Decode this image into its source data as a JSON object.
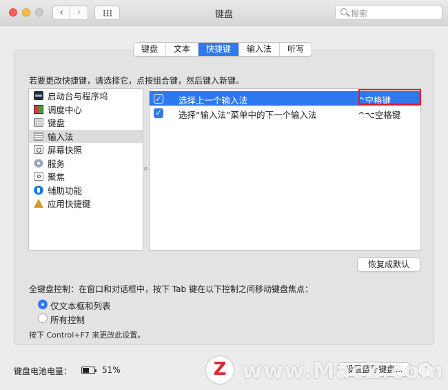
{
  "window": {
    "title": "键盘",
    "search_placeholder": "搜索"
  },
  "tabs": [
    {
      "label": "键盘",
      "active": false
    },
    {
      "label": "文本",
      "active": false
    },
    {
      "label": "快捷键",
      "active": true
    },
    {
      "label": "输入法",
      "active": false
    },
    {
      "label": "听写",
      "active": false
    }
  ],
  "hint": "若要更改快捷键，请选择它，点按组合键，然后键入新键。",
  "categories": [
    {
      "label": "启动台与程序坞",
      "icon": "launchpad-icon"
    },
    {
      "label": "调度中心",
      "icon": "mission-control-icon"
    },
    {
      "label": "键盘",
      "icon": "keyboard-icon"
    },
    {
      "label": "输入法",
      "icon": "input-method-icon",
      "selected": true
    },
    {
      "label": "屏幕快照",
      "icon": "screenshot-icon"
    },
    {
      "label": "服务",
      "icon": "services-gear-icon"
    },
    {
      "label": "聚焦",
      "icon": "spotlight-icon"
    },
    {
      "label": "辅助功能",
      "icon": "accessibility-icon"
    },
    {
      "label": "应用快捷键",
      "icon": "app-shortcuts-icon"
    }
  ],
  "shortcuts": [
    {
      "checked": true,
      "label": "选择上一个输入法",
      "key": "^空格键",
      "selected": true
    },
    {
      "checked": true,
      "label": "选择“输入法”菜单中的下一个输入法",
      "key": "^⌥空格键",
      "selected": false
    }
  ],
  "restore_button": "恢复成默认",
  "full_keyboard": {
    "label": "全键盘控制：在窗口和对话框中，按下 Tab 键在以下控制之间移动键盘焦点：",
    "options": [
      {
        "label": "仅文本框和列表",
        "selected": true
      },
      {
        "label": "所有控制",
        "selected": false
      }
    ],
    "note": "按下 Control+F7 来更改此设置。"
  },
  "footer": {
    "battery_label": "键盘电池电量：",
    "battery_percent": "51%",
    "bluetooth_button": "设置蓝牙键盘...",
    "help": "?"
  },
  "colors": {
    "accent": "#2f79f0",
    "highlight_border": "#d41f2c"
  },
  "watermark": {
    "text": "www.MacZ.com"
  }
}
